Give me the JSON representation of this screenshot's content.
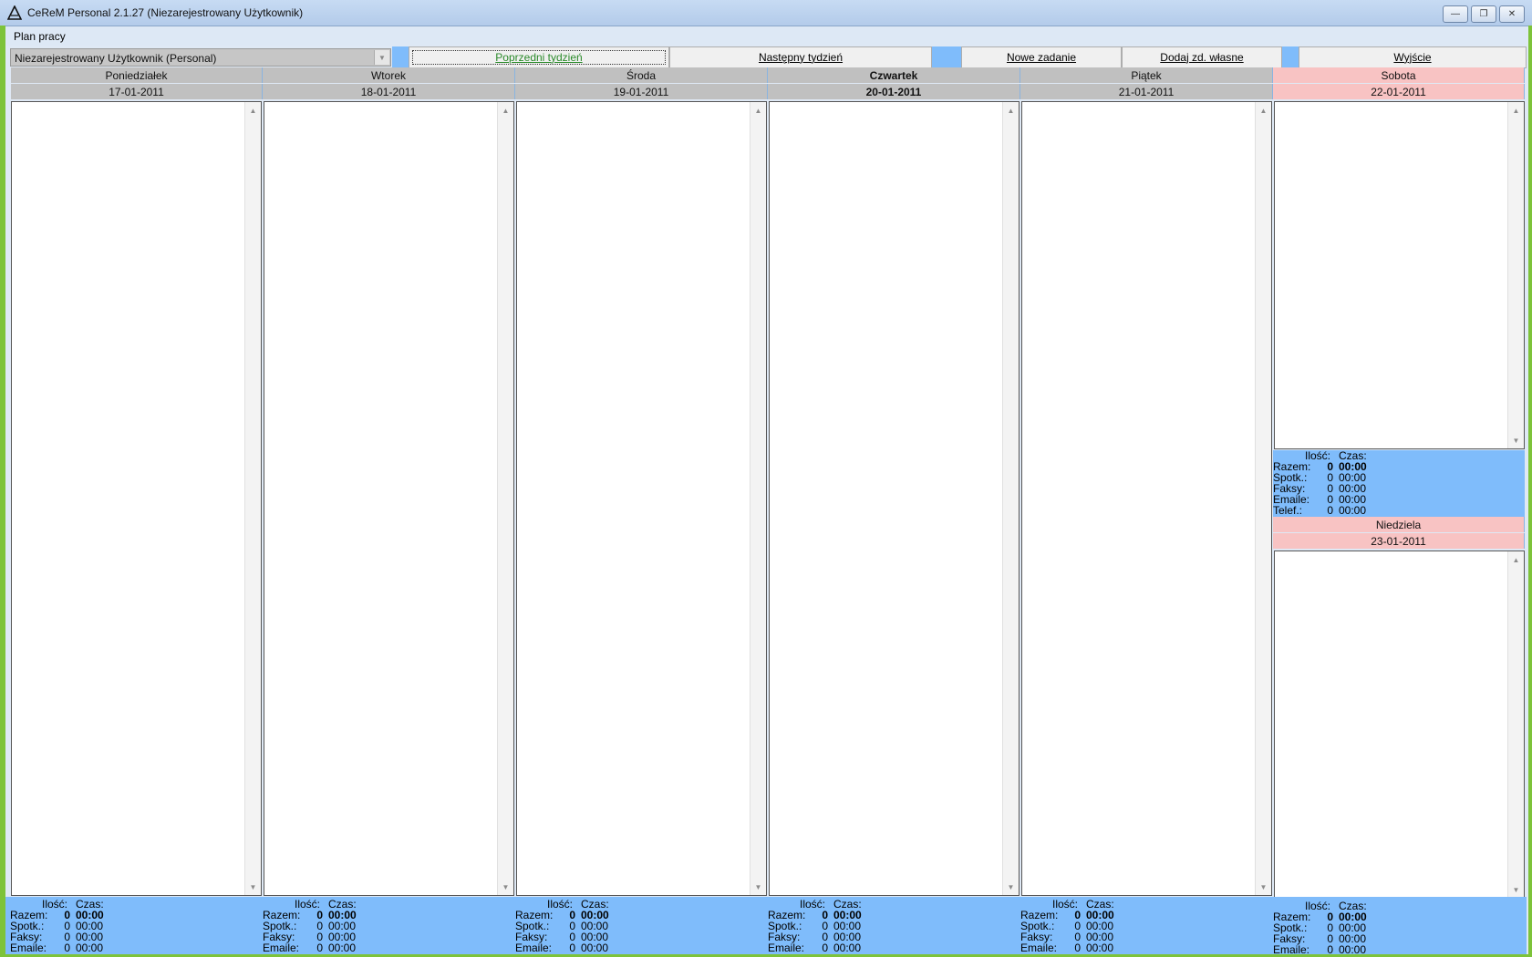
{
  "window": {
    "title": "CeReM Personal 2.1.27 (Niezarejestrowany Użytkownik)",
    "minimize_icon": "minimize-icon",
    "maximize_icon": "restore-icon",
    "close_icon": "close-icon"
  },
  "menu": {
    "items": [
      "Plan pracy"
    ]
  },
  "toolbar": {
    "user_select_value": "Niezarejestrowany Użytkownik (Personal)",
    "prev_week": "Poprzedni tydzień",
    "next_week": "Następny tydzień",
    "new_task": "Nowe zadanie",
    "add_own": "Dodaj zd. własne",
    "exit": "Wyjście"
  },
  "days": [
    {
      "name": "Poniedziałek",
      "date": "17-01-2011",
      "weekend": false,
      "today": false
    },
    {
      "name": "Wtorek",
      "date": "18-01-2011",
      "weekend": false,
      "today": false
    },
    {
      "name": "Środa",
      "date": "19-01-2011",
      "weekend": false,
      "today": false
    },
    {
      "name": "Czwartek",
      "date": "20-01-2011",
      "weekend": false,
      "today": true
    },
    {
      "name": "Piątek",
      "date": "21-01-2011",
      "weekend": false,
      "today": false
    },
    {
      "name": "Sobota",
      "date": "22-01-2011",
      "weekend": true,
      "today": false
    },
    {
      "name": "Niedziela",
      "date": "23-01-2011",
      "weekend": true,
      "today": false
    }
  ],
  "stats_labels": {
    "count_header": "Ilość:",
    "time_header": "Czas:",
    "total": "Razem:",
    "meetings": "Spotk.:",
    "faxes": "Faksy:",
    "emails": "Emaile:",
    "phones": "Telef.:"
  },
  "stats_values": {
    "total_count": "0",
    "total_time": "00:00",
    "meetings_count": "0",
    "meetings_time": "00:00",
    "faxes_count": "0",
    "faxes_time": "00:00",
    "emails_count": "0",
    "emails_time": "00:00",
    "phones_count": "0",
    "phones_time": "00:00"
  },
  "colors": {
    "accent_blue": "#7fbcfb",
    "weekend_pink": "#f8c3c3",
    "header_gray": "#c0c0c0",
    "frame_green": "#7dc33a"
  }
}
